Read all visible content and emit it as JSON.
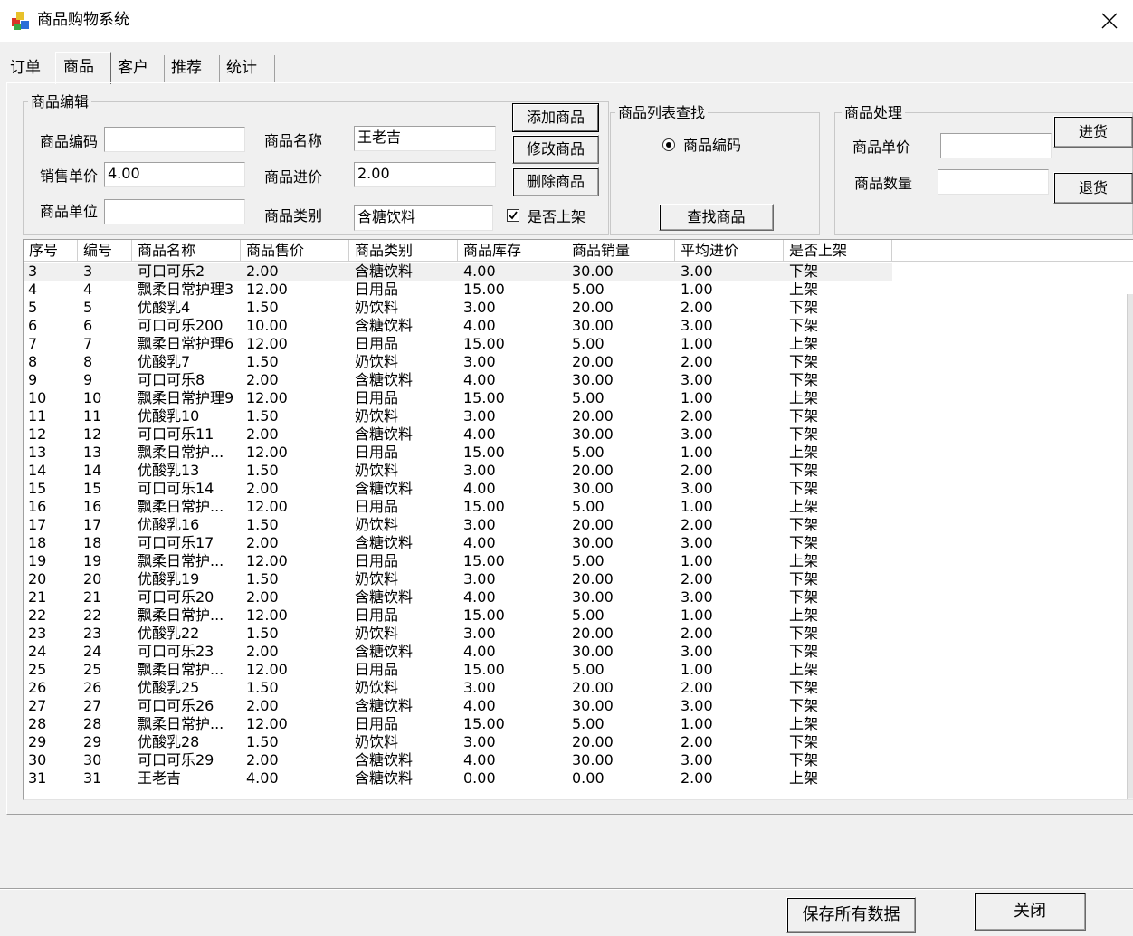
{
  "window": {
    "title": "商品购物系统"
  },
  "tabs": [
    "订单",
    "商品",
    "客户",
    "推荐",
    "统计"
  ],
  "edit_group": {
    "title": "商品编辑",
    "code_label": "商品编码",
    "code_value": "",
    "name_label": "商品名称",
    "name_value": "王老吉",
    "sale_price_label": "销售单价",
    "sale_price_value": "4.00",
    "cost_price_label": "商品进价",
    "cost_price_value": "2.00",
    "unit_label": "商品单位",
    "unit_value": "",
    "category_label": "商品类别",
    "category_value": "含糖饮料",
    "listed_label": "是否上架",
    "listed_checked": true,
    "add_button": "添加商品",
    "modify_button": "修改商品",
    "delete_button": "删除商品"
  },
  "search_group": {
    "title": "商品列表查找",
    "radio_label": "商品编码",
    "find_button": "查找商品"
  },
  "process_group": {
    "title": "商品处理",
    "unit_price_label": "商品单价",
    "unit_price_value": "",
    "quantity_label": "商品数量",
    "quantity_value": "",
    "stock_in_button": "进货",
    "return_button": "退货"
  },
  "table": {
    "columns": [
      "序号",
      "编号",
      "商品名称",
      "商品售价",
      "商品类别",
      "商品库存",
      "商品销量",
      "平均进价",
      "是否上架"
    ],
    "rows": [
      [
        "3",
        "3",
        "可口可乐2",
        "2.00",
        "含糖饮料",
        "4.00",
        "30.00",
        "3.00",
        "下架"
      ],
      [
        "4",
        "4",
        "飘柔日常护理3",
        "12.00",
        "日用品",
        "15.00",
        "5.00",
        "1.00",
        "上架"
      ],
      [
        "5",
        "5",
        "优酸乳4",
        "1.50",
        "奶饮料",
        "3.00",
        "20.00",
        "2.00",
        "下架"
      ],
      [
        "6",
        "6",
        "可口可乐200",
        "10.00",
        "含糖饮料",
        "4.00",
        "30.00",
        "3.00",
        "下架"
      ],
      [
        "7",
        "7",
        "飘柔日常护理6",
        "12.00",
        "日用品",
        "15.00",
        "5.00",
        "1.00",
        "上架"
      ],
      [
        "8",
        "8",
        "优酸乳7",
        "1.50",
        "奶饮料",
        "3.00",
        "20.00",
        "2.00",
        "下架"
      ],
      [
        "9",
        "9",
        "可口可乐8",
        "2.00",
        "含糖饮料",
        "4.00",
        "30.00",
        "3.00",
        "下架"
      ],
      [
        "10",
        "10",
        "飘柔日常护理9",
        "12.00",
        "日用品",
        "15.00",
        "5.00",
        "1.00",
        "上架"
      ],
      [
        "11",
        "11",
        "优酸乳10",
        "1.50",
        "奶饮料",
        "3.00",
        "20.00",
        "2.00",
        "下架"
      ],
      [
        "12",
        "12",
        "可口可乐11",
        "2.00",
        "含糖饮料",
        "4.00",
        "30.00",
        "3.00",
        "下架"
      ],
      [
        "13",
        "13",
        "飘柔日常护...",
        "12.00",
        "日用品",
        "15.00",
        "5.00",
        "1.00",
        "上架"
      ],
      [
        "14",
        "14",
        "优酸乳13",
        "1.50",
        "奶饮料",
        "3.00",
        "20.00",
        "2.00",
        "下架"
      ],
      [
        "15",
        "15",
        "可口可乐14",
        "2.00",
        "含糖饮料",
        "4.00",
        "30.00",
        "3.00",
        "下架"
      ],
      [
        "16",
        "16",
        "飘柔日常护...",
        "12.00",
        "日用品",
        "15.00",
        "5.00",
        "1.00",
        "上架"
      ],
      [
        "17",
        "17",
        "优酸乳16",
        "1.50",
        "奶饮料",
        "3.00",
        "20.00",
        "2.00",
        "下架"
      ],
      [
        "18",
        "18",
        "可口可乐17",
        "2.00",
        "含糖饮料",
        "4.00",
        "30.00",
        "3.00",
        "下架"
      ],
      [
        "19",
        "19",
        "飘柔日常护...",
        "12.00",
        "日用品",
        "15.00",
        "5.00",
        "1.00",
        "上架"
      ],
      [
        "20",
        "20",
        "优酸乳19",
        "1.50",
        "奶饮料",
        "3.00",
        "20.00",
        "2.00",
        "下架"
      ],
      [
        "21",
        "21",
        "可口可乐20",
        "2.00",
        "含糖饮料",
        "4.00",
        "30.00",
        "3.00",
        "下架"
      ],
      [
        "22",
        "22",
        "飘柔日常护...",
        "12.00",
        "日用品",
        "15.00",
        "5.00",
        "1.00",
        "上架"
      ],
      [
        "23",
        "23",
        "优酸乳22",
        "1.50",
        "奶饮料",
        "3.00",
        "20.00",
        "2.00",
        "下架"
      ],
      [
        "24",
        "24",
        "可口可乐23",
        "2.00",
        "含糖饮料",
        "4.00",
        "30.00",
        "3.00",
        "下架"
      ],
      [
        "25",
        "25",
        "飘柔日常护...",
        "12.00",
        "日用品",
        "15.00",
        "5.00",
        "1.00",
        "上架"
      ],
      [
        "26",
        "26",
        "优酸乳25",
        "1.50",
        "奶饮料",
        "3.00",
        "20.00",
        "2.00",
        "下架"
      ],
      [
        "27",
        "27",
        "可口可乐26",
        "2.00",
        "含糖饮料",
        "4.00",
        "30.00",
        "3.00",
        "下架"
      ],
      [
        "28",
        "28",
        "飘柔日常护...",
        "12.00",
        "日用品",
        "15.00",
        "5.00",
        "1.00",
        "上架"
      ],
      [
        "29",
        "29",
        "优酸乳28",
        "1.50",
        "奶饮料",
        "3.00",
        "20.00",
        "2.00",
        "下架"
      ],
      [
        "30",
        "30",
        "可口可乐29",
        "2.00",
        "含糖饮料",
        "4.00",
        "30.00",
        "3.00",
        "下架"
      ],
      [
        "31",
        "31",
        "王老吉",
        "4.00",
        "含糖饮料",
        "0.00",
        "0.00",
        "2.00",
        "上架"
      ]
    ],
    "selected_row": 0
  },
  "footer": {
    "save_button": "保存所有数据",
    "close_button": "关闭"
  },
  "icons": {
    "app": "app-cube-icon",
    "close": "close-icon",
    "radio": "radio-icon",
    "check": "checkbox-icon"
  }
}
